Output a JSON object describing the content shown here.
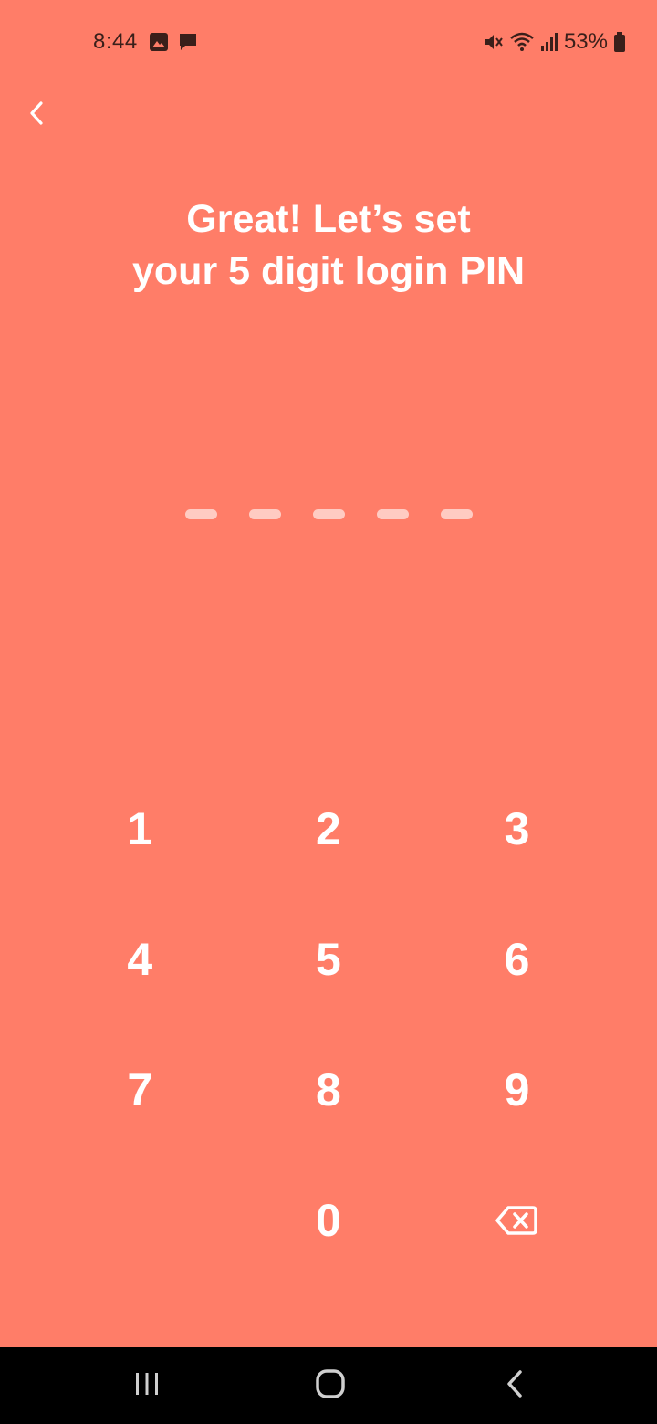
{
  "status_bar": {
    "time": "8:44",
    "battery_text": "53%",
    "icons": [
      "image-icon",
      "message-icon",
      "mute-icon",
      "wifi-icon",
      "signal-icon",
      "battery-icon"
    ]
  },
  "header": {
    "back_icon": "chevron-left-icon"
  },
  "title": {
    "line1": "Great! Let’s set",
    "line2": "your 5 digit login PIN"
  },
  "pin": {
    "length": 5,
    "entered": 0
  },
  "keypad": {
    "rows": [
      [
        "1",
        "2",
        "3"
      ],
      [
        "4",
        "5",
        "6"
      ],
      [
        "7",
        "8",
        "9"
      ],
      [
        "",
        "0",
        "backspace"
      ]
    ],
    "backspace_icon": "backspace-icon"
  },
  "nav_bar": {
    "buttons": [
      "recent-apps-icon",
      "home-icon",
      "back-icon"
    ]
  },
  "colors": {
    "background": "#FF7D68",
    "text": "#FFFFFF",
    "nav_background": "#000000"
  }
}
